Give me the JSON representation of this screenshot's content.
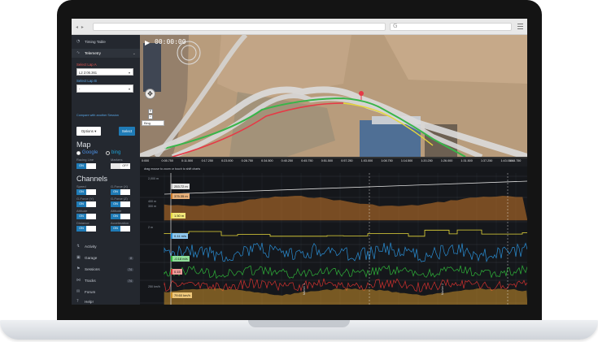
{
  "browser": {
    "nav_arrows": "◂ ▸",
    "search_icon": "G"
  },
  "sidebar": {
    "timing_table": "Timing Table",
    "telemetry": "Telemetry",
    "lap_a_label": "Select Lap A",
    "lap_a_value": "L2 2:06.361",
    "lap_b_label": "Select Lap B",
    "lap_b_value": "-",
    "compare_link": "Compare with another Session",
    "options_button": "Options ▾",
    "select_button": "Select",
    "map_heading": "Map",
    "map_google": "Google",
    "map_bing": "bing",
    "racing_line_label": "Racing Line",
    "markers_label": "Markers",
    "channels_heading": "Channels",
    "channels": [
      {
        "label": "Speed",
        "state": "ON"
      },
      {
        "label": "G-Force (X)",
        "state": "ON"
      },
      {
        "label": "G-Force (Y)",
        "state": "ON"
      },
      {
        "label": "G-Force (Z)",
        "state": "ON"
      },
      {
        "label": "Altitude",
        "state": "ON"
      },
      {
        "label": "Altitude",
        "state": "ON"
      },
      {
        "label": "Distance",
        "state": "ON"
      },
      {
        "label": "Acceleration",
        "state": "ON"
      }
    ],
    "racing_line_state": "ON",
    "markers_state": "OFF",
    "nav": [
      {
        "label": "Activity",
        "badge": ""
      },
      {
        "label": "Garage",
        "badge": "8"
      },
      {
        "label": "Sessions",
        "badge": "74"
      },
      {
        "label": "Tracks",
        "badge": "74"
      },
      {
        "label": "Forum",
        "badge": ""
      },
      {
        "label": "Help!",
        "badge": ""
      }
    ]
  },
  "map": {
    "timecode": "00:00:00",
    "map_type": "Bing"
  },
  "timeline": {
    "ticks": [
      "0:000",
      "0:05.750",
      "0:11.500",
      "0:17.250",
      "0:23.000",
      "0:28.750",
      "0:34.500",
      "0:40.250",
      "0:45.750",
      "0:51.500",
      "0:57.250",
      "1:03.000",
      "1:08.750",
      "1:14.500",
      "1:20.250",
      "1:26.000",
      "1:31.500",
      "1:37.250",
      "1:43.000",
      "1:48.750"
    ]
  },
  "charts": {
    "caption": "drag mouse to zoom or touch to shift charts",
    "tags": [
      "253.72 m",
      "375.35 m",
      "1.50 m",
      "0.11 m/s",
      "-0.18 m/s",
      "0.15",
      "79.60 km/h"
    ],
    "axis_labels": [
      "2,000 m",
      "400 m",
      "300 m",
      "2 m",
      "250 km/h"
    ],
    "markers": [
      "Marker 1",
      "Marker 2"
    ]
  },
  "colors": {
    "altitude": "#c9782a",
    "distance": "#e6d83a",
    "gx": "#2a8fd6",
    "gy": "#2fb53a",
    "gz": "#d2312f",
    "speed": "#c9902a",
    "accent": "#1f7bb6"
  }
}
